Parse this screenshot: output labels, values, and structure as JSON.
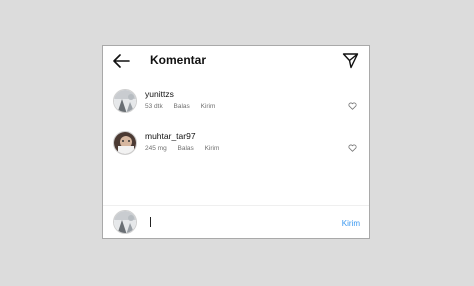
{
  "header": {
    "title": "Komentar",
    "back_icon": "arrow-left-icon",
    "share_icon": "paper-plane-icon"
  },
  "comments": [
    {
      "username": "yunittzs",
      "time": "53 dtk",
      "reply_label": "Balas",
      "send_label": "Kirim",
      "like_icon": "heart-outline-icon"
    },
    {
      "username": "muhtar_tar97",
      "time": "245 mg",
      "reply_label": "Balas",
      "send_label": "Kirim",
      "like_icon": "heart-outline-icon"
    }
  ],
  "composer": {
    "input_value": "",
    "placeholder": "",
    "send_label": "Kirim"
  },
  "colors": {
    "accent": "#3897f0",
    "background": "#dcdcdc",
    "panel": "#ffffff",
    "meta_text": "#707070"
  }
}
